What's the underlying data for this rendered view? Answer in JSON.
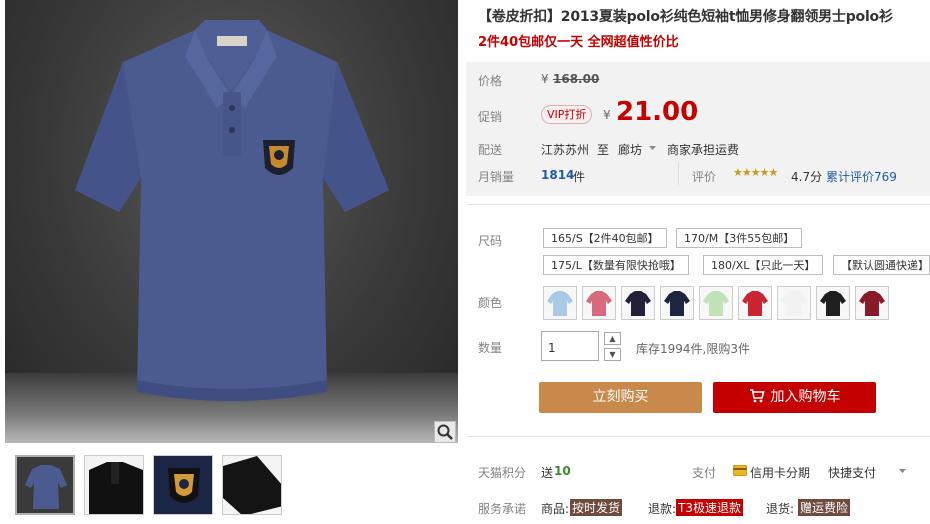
{
  "product": {
    "title": "【卷皮折扣】2013夏装polo衫纯色短袖t恤男修身翻领男士polo衫",
    "subtitle": "2件40包邮仅一天 全网超值性价比"
  },
  "price": {
    "original_label": "价格",
    "currency": "¥",
    "original_value": "168.00",
    "promo_label": "促销",
    "vip_badge": "VIP打折",
    "promo_value": "21.00"
  },
  "shipping": {
    "label": "配送",
    "from": "江苏苏州",
    "to_word": "至",
    "destination": "廊坊",
    "note": "商家承担运费"
  },
  "sales": {
    "monthly_label": "月销量",
    "monthly_value": "1814",
    "unit": "件",
    "rating_label": "评价",
    "stars": "★★★★★",
    "rating_score": "4.7分",
    "review_text": "累计评价769",
    "rating_value": 4.7
  },
  "sku": {
    "size_label": "尺码",
    "sizes": [
      "165/S【2件40包邮】",
      "170/M【3件55包邮】",
      "175/L【数量有限快抢哦】",
      "180/XL【只此一天】",
      "【默认圆通快递】"
    ],
    "color_label": "颜色",
    "colors": [
      "#a9c9e6",
      "#d86a7d",
      "#24203a",
      "#1d2540",
      "#bfe2b6",
      "#cc2331",
      "#f2f2f2",
      "#1f1f1f",
      "#8a1a2a"
    ]
  },
  "quantity": {
    "label": "数量",
    "value": "1",
    "stock_text": "库存1994件,限购3件"
  },
  "actions": {
    "buy_now": "立刻购买",
    "add_to_cart": "加入购物车"
  },
  "points": {
    "label": "天猫积分",
    "send_word": "送",
    "value": "10",
    "pay_label": "支付",
    "credit_installment": "信用卡分期",
    "quick_pay": "快捷支付"
  },
  "service": {
    "label": "服务承诺",
    "goods_label": "商品:",
    "goods_tag": "按时发货",
    "refund_label": "退款:",
    "refund_tag": "T3极速退款",
    "return_label": "退货:",
    "return_tag": "赠运费险"
  },
  "colors": {
    "accent_red": "#c40000",
    "buy_orange": "#c9894a",
    "shirt_blue": "#4d5e93"
  }
}
